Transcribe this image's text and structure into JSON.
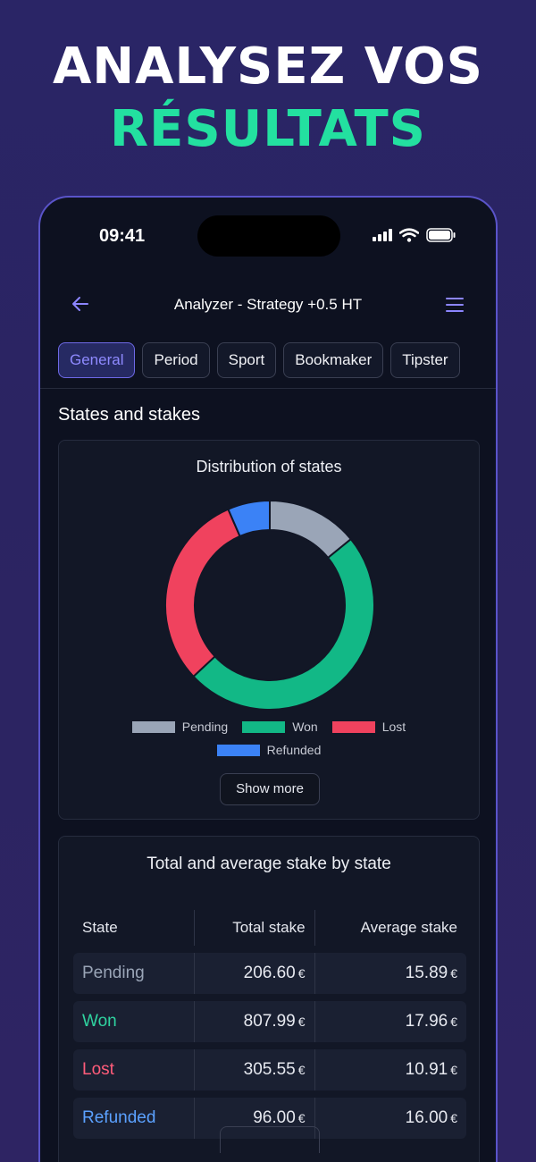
{
  "promo": {
    "line1": "ANALYSEZ VOS",
    "line2": "RÉSULTATS",
    "line2_color": "#23e0a0"
  },
  "status_bar": {
    "time": "09:41",
    "icons": [
      "signal-icon",
      "wifi-icon",
      "battery-icon"
    ]
  },
  "header": {
    "back_icon": "arrow-left-icon",
    "title": "Analyzer - Strategy +0.5 HT",
    "menu_icon": "menu-icon"
  },
  "tabs": [
    {
      "label": "General",
      "active": true
    },
    {
      "label": "Period",
      "active": false
    },
    {
      "label": "Sport",
      "active": false
    },
    {
      "label": "Bookmaker",
      "active": false
    },
    {
      "label": "Tipster",
      "active": false
    }
  ],
  "section": {
    "title": "States and stakes"
  },
  "distribution": {
    "title": "Distribution of states",
    "show_more": "Show more"
  },
  "chart_data": {
    "type": "pie",
    "title": "Distribution of states",
    "categories": [
      "Pending",
      "Won",
      "Lost",
      "Refunded"
    ],
    "values": [
      13,
      45,
      28,
      6
    ],
    "colors": [
      "#9aa5b7",
      "#12b886",
      "#f0425e",
      "#3b82f6"
    ],
    "legend_position": "bottom"
  },
  "stakes": {
    "title": "Total and average stake by state",
    "columns": [
      "State",
      "Total stake",
      "Average stake"
    ],
    "currency": "€",
    "rows": [
      {
        "state": "Pending",
        "total": "206.60",
        "average": "15.89",
        "color": "#9aa5b7"
      },
      {
        "state": "Won",
        "total": "807.99",
        "average": "17.96",
        "color": "#2fd3a0"
      },
      {
        "state": "Lost",
        "total": "305.55",
        "average": "10.91",
        "color": "#ff5c7a"
      },
      {
        "state": "Refunded",
        "total": "96.00",
        "average": "16.00",
        "color": "#5ba1ff"
      }
    ]
  }
}
